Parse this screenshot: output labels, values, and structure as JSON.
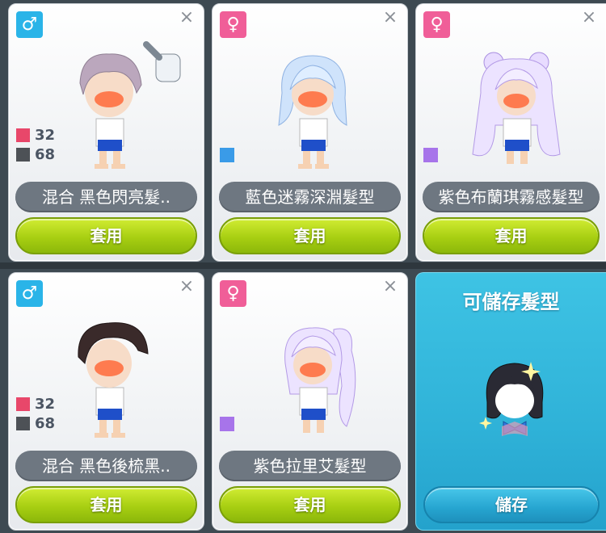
{
  "colors": {
    "male": "#2ab4e8",
    "female": "#f05e98",
    "apply_green": "#a8cf12",
    "save_blue": "#2fb2d8",
    "pill_gray": "#6e7781"
  },
  "cards": [
    {
      "gender_icon": "♂",
      "gender": "male",
      "close": "×",
      "stats": [
        {
          "color": "#e8476a",
          "value": "32"
        },
        {
          "color": "#4d5156",
          "value": "68"
        }
      ],
      "name": "混合 黑色閃亮髮..",
      "apply_label": "套用"
    },
    {
      "gender_icon": "♀",
      "gender": "female",
      "close": "×",
      "chip_color": "#3a9be8",
      "name": "藍色迷霧深淵髮型",
      "apply_label": "套用"
    },
    {
      "gender_icon": "♀",
      "gender": "female",
      "close": "×",
      "chip_color": "#a774ea",
      "name": "紫色布蘭琪霧感髮型",
      "apply_label": "套用"
    },
    {
      "gender_icon": "♂",
      "gender": "male",
      "close": "×",
      "stats": [
        {
          "color": "#e8476a",
          "value": "32"
        },
        {
          "color": "#4d5156",
          "value": "68"
        }
      ],
      "name": "混合 黑色後梳黑..",
      "apply_label": "套用"
    },
    {
      "gender_icon": "♀",
      "gender": "female",
      "close": "×",
      "chip_color": "#a774ea",
      "name": "紫色拉里艾髮型",
      "apply_label": "套用"
    }
  ],
  "save_panel": {
    "title": "可儲存髮型",
    "button_label": "儲存"
  }
}
